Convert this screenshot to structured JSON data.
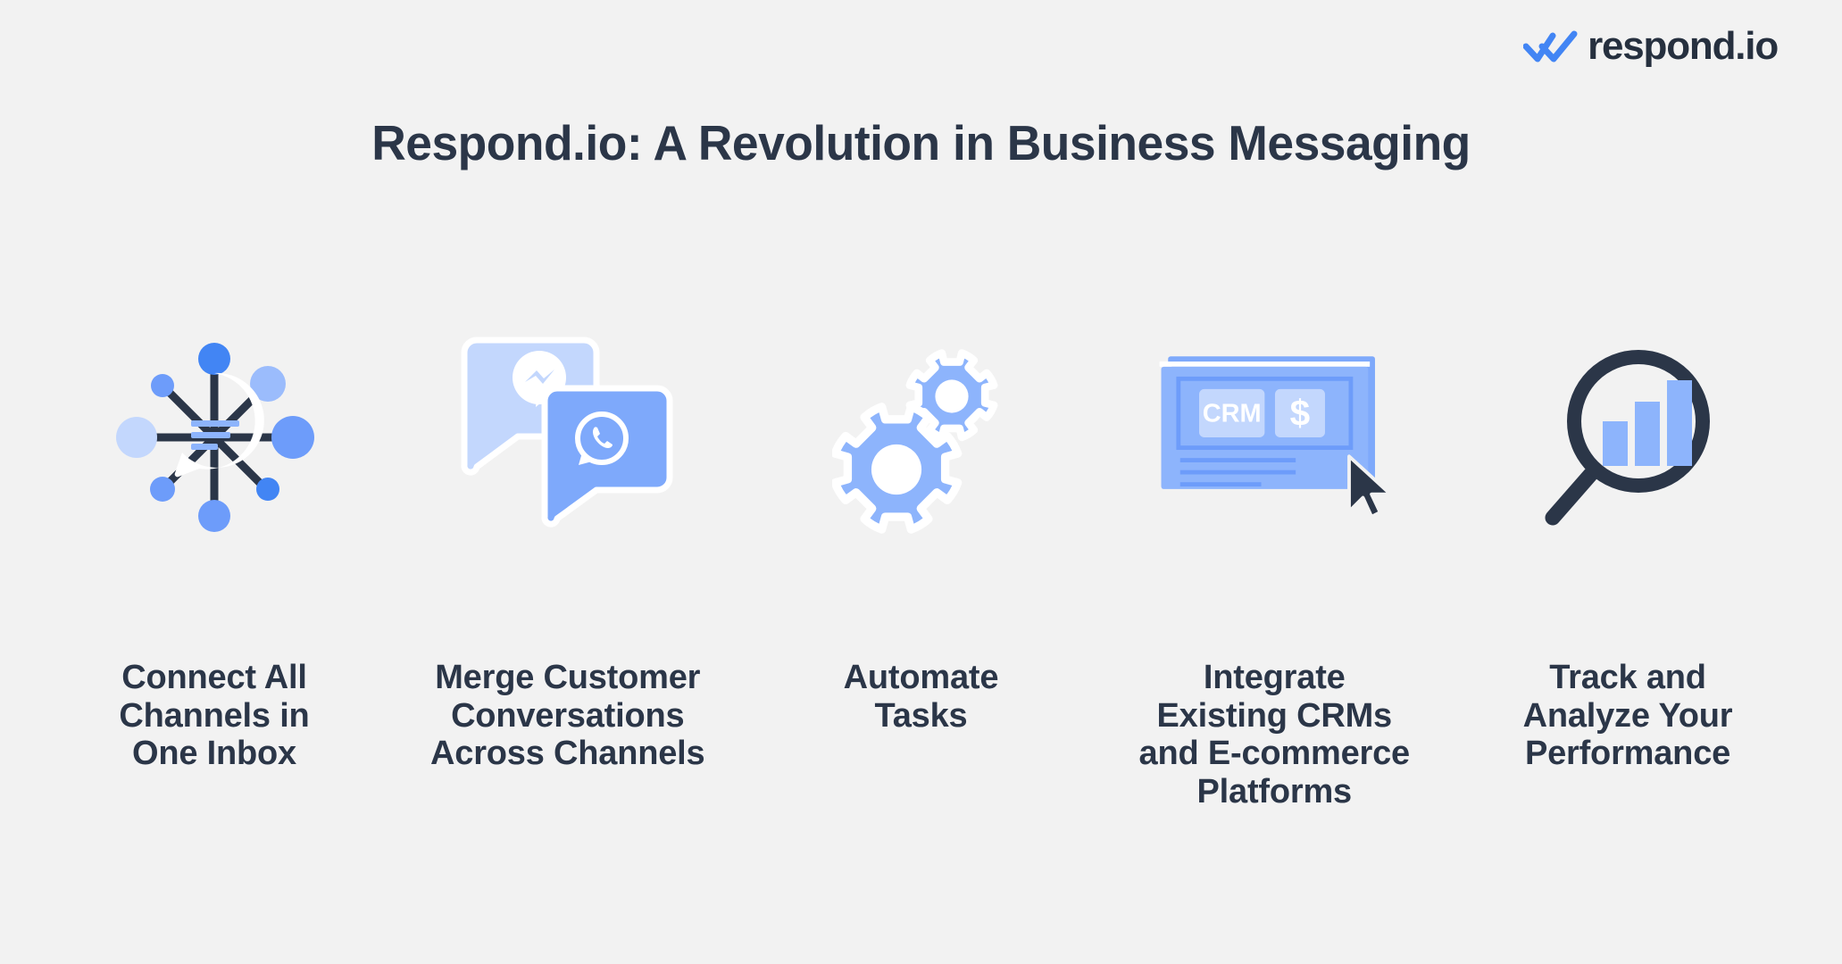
{
  "background_color": "#f2f2f2",
  "brand": {
    "name": "respond.io",
    "logo_icon": "double-check-icon",
    "logo_color": "#4285f4",
    "text_color": "#26303f"
  },
  "header": {
    "title": "Respond.io: A Revolution in Business Messaging",
    "title_color": "#2b3648"
  },
  "palette": {
    "navy": "#2b3648",
    "blue_vivid": "#4285f4",
    "blue_mid": "#7ea9fb",
    "blue_soft": "#9bbcfc",
    "blue_pale": "#c3d7fd",
    "white": "#ffffff"
  },
  "features": [
    {
      "id": "connect-channels",
      "icon": "network-speech-bubble-icon",
      "label": "Connect All\nChannels in\nOne Inbox"
    },
    {
      "id": "merge-conversations",
      "icon": "messenger-whatsapp-bubbles-icon",
      "label": "Merge Customer\nConversations\nAcross Channels"
    },
    {
      "id": "automate-tasks",
      "icon": "gears-icon",
      "label": "Automate\nTasks"
    },
    {
      "id": "integrate-crm",
      "icon": "crm-window-cursor-icon",
      "label": "Integrate\nExisting CRMs\nand E-commerce\nPlatforms"
    },
    {
      "id": "track-performance",
      "icon": "magnifier-bar-chart-icon",
      "label": "Track and\nAnalyze Your\nPerformance"
    }
  ],
  "icon_details": {
    "crm_window": {
      "tile_1_label": "CRM",
      "tile_2_label": "$"
    }
  }
}
